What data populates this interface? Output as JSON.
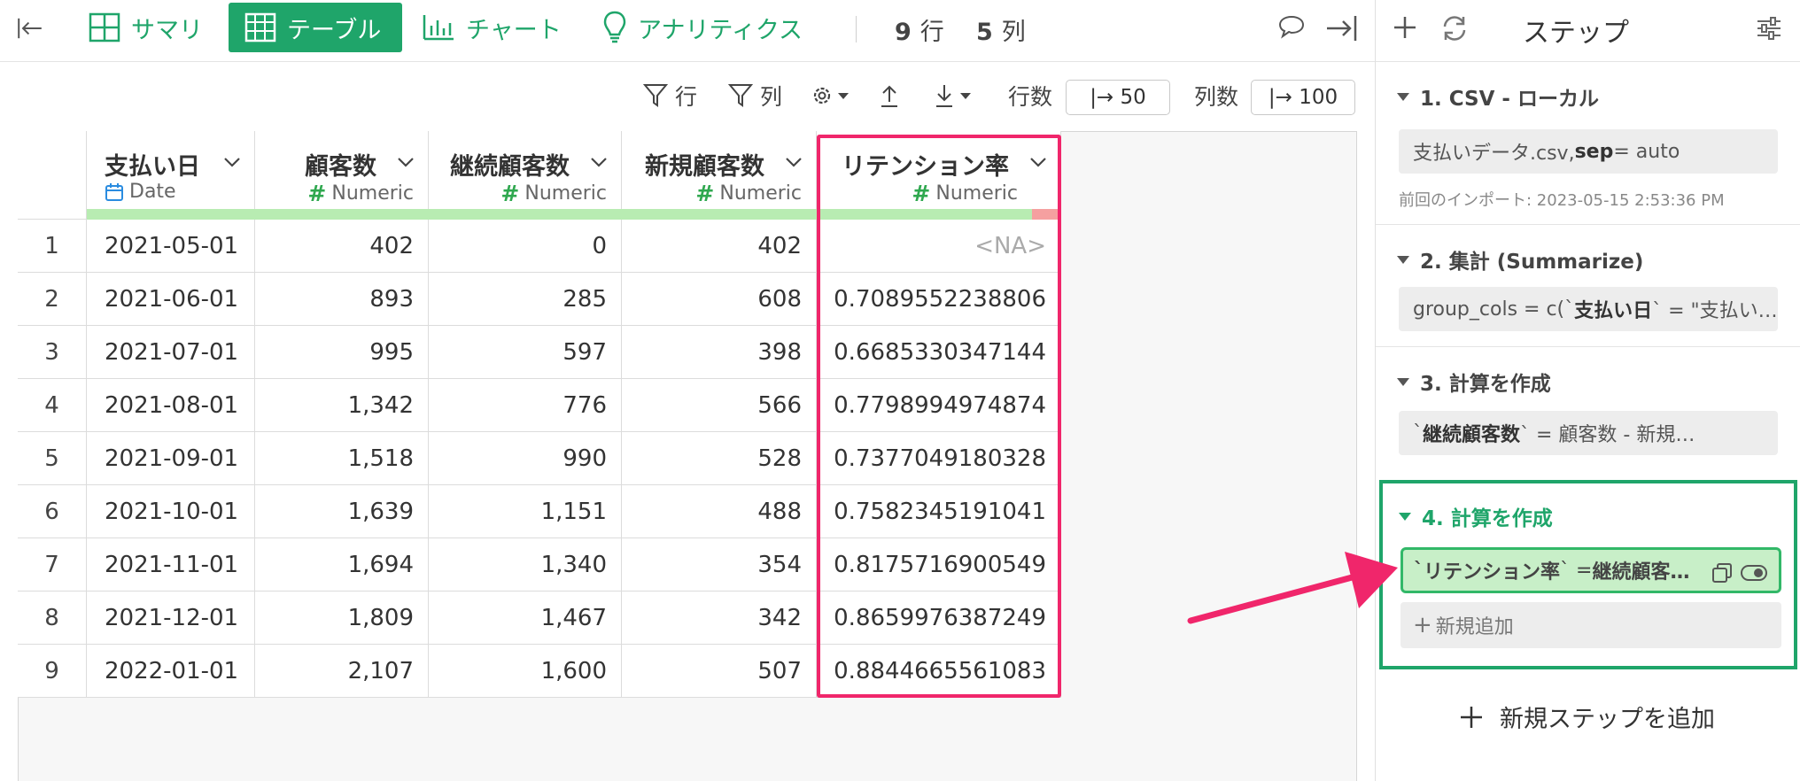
{
  "nav": {
    "tabs": [
      {
        "label": "サマリ"
      },
      {
        "label": "テーブル"
      },
      {
        "label": "チャート"
      },
      {
        "label": "アナリティクス"
      }
    ],
    "rows_count": "9",
    "rows_unit": "行",
    "cols_count": "5",
    "cols_unit": "列"
  },
  "toolbar": {
    "filter_rows": "行",
    "filter_cols": "列",
    "row_limit_label": "行数",
    "row_limit_value": "|→ 50",
    "col_limit_label": "列数",
    "col_limit_value": "|→ 100"
  },
  "table": {
    "columns": [
      {
        "name": "支払い日",
        "type": "Date"
      },
      {
        "name": "顧客数",
        "type": "Numeric"
      },
      {
        "name": "継続顧客数",
        "type": "Numeric"
      },
      {
        "name": "新規顧客数",
        "type": "Numeric"
      },
      {
        "name": "リテンション率",
        "type": "Numeric"
      }
    ],
    "rows": [
      [
        "1",
        "2021-05-01",
        "402",
        "0",
        "402",
        "<NA>"
      ],
      [
        "2",
        "2021-06-01",
        "893",
        "285",
        "608",
        "0.7089552238806"
      ],
      [
        "3",
        "2021-07-01",
        "995",
        "597",
        "398",
        "0.6685330347144"
      ],
      [
        "4",
        "2021-08-01",
        "1,342",
        "776",
        "566",
        "0.7798994974874"
      ],
      [
        "5",
        "2021-09-01",
        "1,518",
        "990",
        "528",
        "0.7377049180328"
      ],
      [
        "6",
        "2021-10-01",
        "1,639",
        "1,151",
        "488",
        "0.7582345191041"
      ],
      [
        "7",
        "2021-11-01",
        "1,694",
        "1,340",
        "354",
        "0.8175716900549"
      ],
      [
        "8",
        "2021-12-01",
        "1,809",
        "1,467",
        "342",
        "0.8659976387249"
      ],
      [
        "9",
        "2022-01-01",
        "2,107",
        "1,600",
        "507",
        "0.8844665561083"
      ]
    ]
  },
  "sidebar": {
    "title": "ステップ",
    "steps": [
      {
        "title": "1. CSV - ローカル",
        "cmd_a": "支払いデータ.csv, ",
        "cmd_b": "sep",
        "cmd_c": " = auto",
        "note": "前回のインポート: 2023-05-15 2:53:36 PM"
      },
      {
        "title": "2. 集計 (Summarize)",
        "cmd_a": "group_cols = c(`",
        "cmd_b": "支払い日",
        "cmd_c": "` = \"支払い…"
      },
      {
        "title": "3. 計算を作成",
        "cmd_a": "`",
        "cmd_b": "継続顧客数",
        "cmd_c": "` = 顧客数 - 新規…"
      },
      {
        "title": "4. 計算を作成",
        "cmd_a": "`",
        "cmd_b": "リテンション率",
        "cmd_c": "` = ",
        "cmd_d": "継続顧客…",
        "add_label": "新規追加"
      }
    ],
    "add_step_label": "新規ステップを追加"
  },
  "colors": {
    "accent": "#1fa56a",
    "highlight": "#f0266b",
    "type_bar": "#b8ecb2"
  }
}
